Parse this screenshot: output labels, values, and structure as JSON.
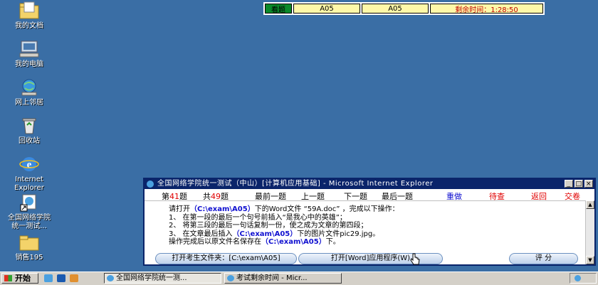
{
  "desktop_icons": [
    {
      "label": "我的文档",
      "icon": "folder-documents-icon"
    },
    {
      "label": "我的电脑",
      "icon": "computer-icon"
    },
    {
      "label": "网上邻居",
      "icon": "network-icon"
    },
    {
      "label": "回收站",
      "icon": "recycle-bin-icon"
    },
    {
      "label": "Internet\nExplorer",
      "icon": "internet-explorer-icon"
    },
    {
      "label": "全国网络学院\n统一测试...",
      "icon": "shortcut-icon"
    },
    {
      "label": "销售195",
      "icon": "folder-icon"
    }
  ],
  "exam_bar": {
    "button": "看题",
    "cell1": "A05",
    "cell2": "A05",
    "time": "剩余时间：1:28:50"
  },
  "ie_window": {
    "title": "全国网络学院统一测试（中山）[计算机应用基础] - Microsoft Internet Explorer",
    "nav": {
      "current_prefix": "第",
      "current_num": "41",
      "current_suffix": "题",
      "total_prefix": "共",
      "total_num": "49",
      "total_suffix": "题",
      "first": "最前一题",
      "prev": "上一题",
      "next": "下一题",
      "last": "最后一题",
      "redo": "重做",
      "pending": "待查",
      "back": "返回",
      "submit": "交卷"
    },
    "instructions": {
      "l1a": "请打开",
      "l1b": "（C:\\exam\\A05）",
      "l1c": "下的Word文件 “59A.doc” ，完成以下操作：",
      "l2": "1、 在第一段的最后一个句号前插入“是我心中的英雄”；",
      "l3": "2、 将第三段的最后一句话复制一份，使之成为文章的第四段；",
      "l4a": "3、 在文章最后插入",
      "l4b": "（C:\\exam\\A05）",
      "l4c": "下的图片文件pic29.jpg。",
      "l5a": "操作完成后以原文件名保存在",
      "l5b": "（C:\\exam\\A05）",
      "l5c": "下。"
    },
    "open_folder_button": "打开考生文件夹：[C:\\exam\\A05]",
    "open_word_button": "打开[Word]应用程序(W)",
    "score_button": "评 分"
  },
  "taskbar": {
    "start": "开始",
    "tasks": [
      "全国网络学院统一测...",
      "考试剩余时间 - Micr..."
    ]
  },
  "colors": {
    "desktop": "#3a6ea5",
    "title_bar": "#0a246a",
    "nav_red": "#e00000",
    "nav_blue": "#1010d0",
    "timer_red": "#c00000",
    "exam_green": "#0a8a2a"
  }
}
